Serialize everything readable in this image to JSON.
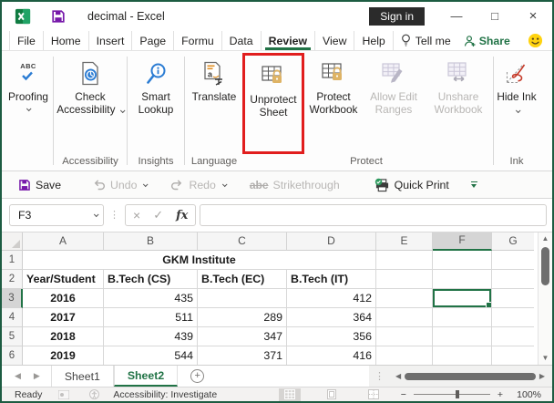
{
  "titlebar": {
    "title": "decimal - Excel",
    "sign_in_label": "Sign in"
  },
  "menu": {
    "tabs": [
      "File",
      "Home",
      "Insert",
      "Page",
      "Formu",
      "Data",
      "Review",
      "View",
      "Help"
    ],
    "active_tab": "Review",
    "tell_me_label": "Tell me",
    "share_label": "Share"
  },
  "ribbon": {
    "proofing_label": "Proofing",
    "check_accessibility_label": "Check Accessibility",
    "smart_lookup_label": "Smart Lookup",
    "translate_label": "Translate",
    "unprotect_sheet_label": "Unprotect Sheet",
    "protect_workbook_label": "Protect Workbook",
    "allow_edit_ranges_label": "Allow Edit Ranges",
    "unshare_workbook_label": "Unshare Workbook",
    "hide_ink_label": "Hide Ink",
    "group_accessibility": "Accessibility",
    "group_insights": "Insights",
    "group_language": "Language",
    "group_protect": "Protect",
    "group_ink": "Ink"
  },
  "qat": {
    "save_label": "Save",
    "undo_label": "Undo",
    "redo_label": "Redo",
    "strikethrough_label": "Strikethrough",
    "quick_print_label": "Quick Print"
  },
  "formula_bar": {
    "name_box_value": "F3",
    "fx_label": "fx",
    "formula_value": ""
  },
  "sheet": {
    "columns": [
      "A",
      "B",
      "C",
      "D",
      "E",
      "F",
      "G"
    ],
    "selected_cell": "F3",
    "row1": {
      "n": "1",
      "merged_title": "GKM Institute"
    },
    "rows": [
      {
        "n": "2",
        "cells": [
          "Year/Student",
          "B.Tech (CS)",
          "B.Tech (EC)",
          "B.Tech (IT)",
          "",
          "",
          ""
        ]
      },
      {
        "n": "3",
        "cells": [
          "2016",
          "435",
          "",
          "412",
          "",
          "",
          ""
        ]
      },
      {
        "n": "4",
        "cells": [
          "2017",
          "511",
          "289",
          "364",
          "",
          "",
          ""
        ]
      },
      {
        "n": "5",
        "cells": [
          "2018",
          "439",
          "347",
          "356",
          "",
          "",
          ""
        ]
      },
      {
        "n": "6",
        "cells": [
          "2019",
          "544",
          "371",
          "416",
          "",
          "",
          ""
        ]
      }
    ]
  },
  "sheet_tabs": {
    "sheets": [
      "Sheet1",
      "Sheet2"
    ],
    "active_sheet": "Sheet2"
  },
  "status_bar": {
    "mode": "Ready",
    "accessibility": "Accessibility: Investigate",
    "zoom_level": "100%"
  },
  "colors": {
    "excel_green": "#217346",
    "highlight_red": "#e11e1e",
    "lock_gold": "#deb365",
    "save_purple": "#7719aa"
  }
}
